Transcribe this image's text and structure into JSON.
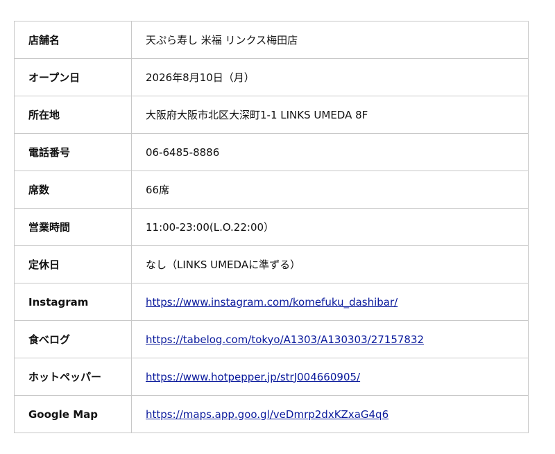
{
  "store_info": {
    "rows": [
      {
        "label": "店舗名",
        "value": "天ぷら寿し 米福 リンクス梅田店"
      },
      {
        "label": "オープン日",
        "value": "2026年8月10日（月）"
      },
      {
        "label": "所在地",
        "value": "大阪府大阪市北区大深町1-1 LINKS UMEDA 8F"
      },
      {
        "label": "電話番号",
        "value": "06-6485-8886"
      },
      {
        "label": "席数",
        "value": "66席"
      },
      {
        "label": "営業時間",
        "value": "11:00-23:00(L.O.22:00）"
      },
      {
        "label": "定休日",
        "value": "なし（LINKS UMEDAに準ずる）"
      },
      {
        "label": "Instagram",
        "value": "https://www.instagram.com/komefuku_dashibar/"
      },
      {
        "label": "食べログ",
        "value": "https://tabelog.com/tokyo/A1303/A130303/27157832"
      },
      {
        "label": "ホットペッパー",
        "value": "https://www.hotpepper.jp/strJ004660905/"
      },
      {
        "label": "Google Map",
        "value": "https://maps.app.goo.gl/veDmrp2dxKZxaG4q6"
      }
    ]
  },
  "colors": {
    "link": "#0a1a9c",
    "border": "#c8c8c8",
    "text": "#111111"
  }
}
